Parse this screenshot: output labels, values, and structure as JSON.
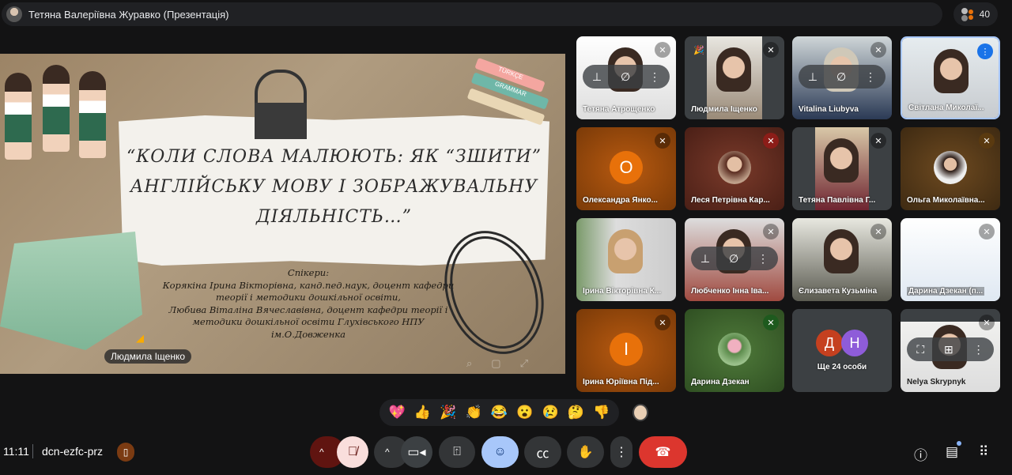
{
  "meeting": {
    "presenter_title": "Тетяна Валеріївна Журавко (Презентація)",
    "participant_count": "40",
    "time": "11:11",
    "code": "dcn-ezfc-prz"
  },
  "slide": {
    "title_lines": [
      "“КОЛИ СЛОВА МАЛЮЮТЬ: ЯК “ЗШИТИ”",
      "АНГЛІЙСЬКУ МОВУ І ЗОБРАЖУВАЛЬНУ",
      "ДІЯЛЬНІСТЬ…”"
    ],
    "speakers_lines": [
      "Спікери:",
      "Корякіна Ірина Вікторівна, канд.пед.наук, доцент кафедри",
      "теорії і методики дошкільної освіти,",
      "Любива Віталіна Вячеславівна, доцент кафедри теорії і",
      "методики дошкільної освіти Глухівського НПУ",
      "ім.О.Довженка"
    ],
    "book_labels": [
      "TÜRKÇE",
      "GRAMMAR"
    ],
    "current_speaker": "Людмила Іщенко"
  },
  "tiles": [
    {
      "name": "Тетяна Атрощенко"
    },
    {
      "name": "Людмила Іщенко"
    },
    {
      "name": "Vitalina Liubyva"
    },
    {
      "name": "Світлана Миколаї..."
    },
    {
      "name": "Олександра Янко...",
      "letter": "О",
      "color": "#e8710a"
    },
    {
      "name": "Леся Петрівна Кар..."
    },
    {
      "name": "Тетяна Павлівна Г..."
    },
    {
      "name": "Ольга Миколаївна..."
    },
    {
      "name": "Ірина Вікторівна К..."
    },
    {
      "name": "Любченко Інна Іва..."
    },
    {
      "name": "Єлизавета Кузьміна"
    },
    {
      "name": "Дарина Дзекан (п..."
    },
    {
      "name": "Ірина Юріївна Під...",
      "letter": "І",
      "color": "#e8710a"
    },
    {
      "name": "Дарина Дзекан"
    },
    {
      "name": "Ще 24 особи",
      "letters": [
        "Д",
        "Н"
      ]
    },
    {
      "name": "Nelya Skrypnyk"
    }
  ],
  "reactions": [
    "💖",
    "👍",
    "🎉",
    "👏",
    "😂",
    "😮",
    "😢",
    "🤔",
    "👎"
  ],
  "colors": {
    "end_call": "#dc362e",
    "emoji_active": "#a8c7fa",
    "mic_off": "#f9dedc"
  }
}
